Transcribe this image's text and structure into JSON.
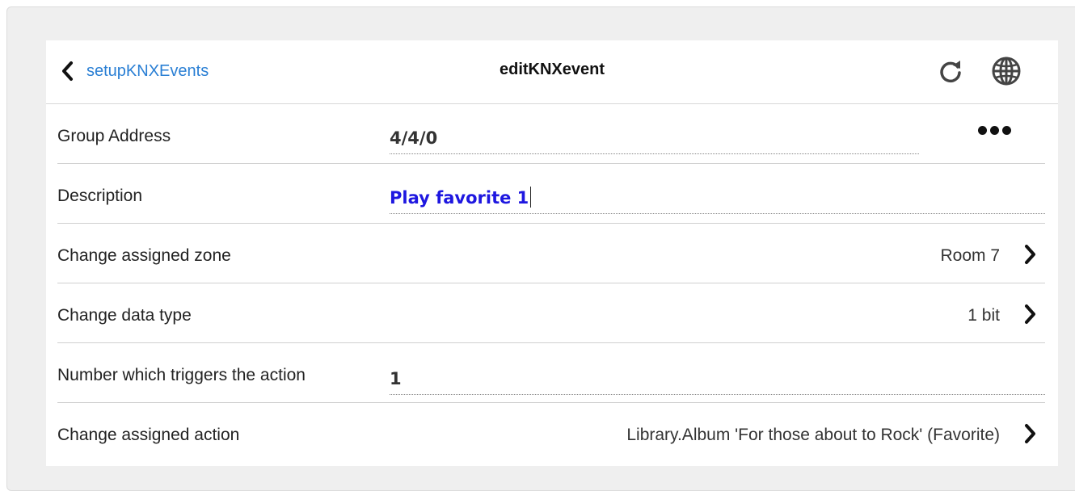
{
  "header": {
    "back_label": "setupKNXEvents",
    "title": "editKNXevent",
    "icons": [
      "chevron-left-icon",
      "refresh-icon",
      "globe-icon"
    ]
  },
  "rows": {
    "group_address": {
      "label": "Group Address",
      "value": "4/4/0",
      "menu_icon": "more-dots-icon"
    },
    "description": {
      "label": "Description",
      "value": "Play favorite 1"
    },
    "zone": {
      "label": "Change assigned zone",
      "value": "Room 7"
    },
    "data_type": {
      "label": "Change data type",
      "value": "1 bit"
    },
    "trigger_number": {
      "label": "Number which triggers the action",
      "value": "1"
    },
    "action": {
      "label": "Change assigned action",
      "value": "Library.Album 'For those about to Rock' (Favorite)"
    }
  },
  "colors": {
    "link": "#2a7fd4",
    "description_text": "#1e17e0",
    "background": "#efefef",
    "card": "#ffffff"
  }
}
